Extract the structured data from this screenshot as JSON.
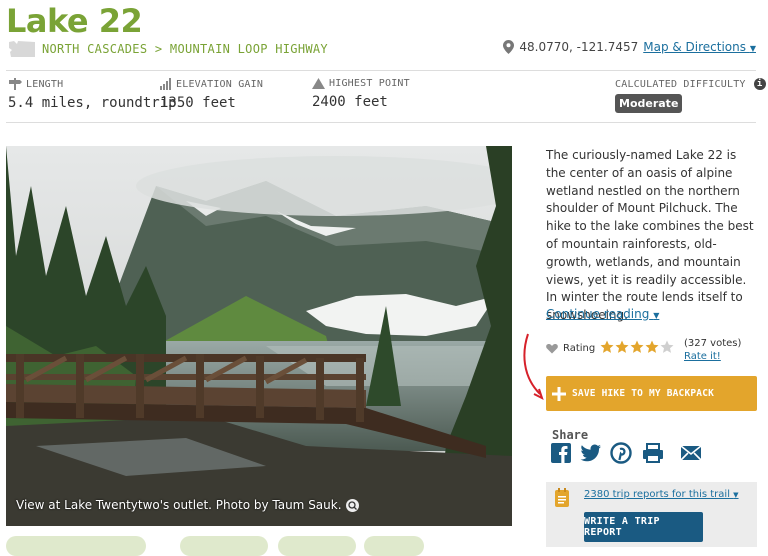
{
  "hike": {
    "title": "Lake 22",
    "breadcrumb": "NORTH CASCADES > MOUNTAIN LOOP HIGHWAY",
    "coordinates": "48.0770, -121.7457",
    "map_link": "Map & Directions"
  },
  "stats": {
    "length_label": "LENGTH",
    "length_value": "5.4 miles, roundtrip",
    "gain_label": "ELEVATION GAIN",
    "gain_value": "1350 feet",
    "high_label": "HIGHEST POINT",
    "high_value": "2400 feet",
    "difficulty_label": "CALCULATED DIFFICULTY",
    "difficulty_value": "Moderate"
  },
  "photo": {
    "caption": "View at Lake Twentytwo's outlet. Photo by Taum Sauk."
  },
  "description": {
    "text": "The curiously-named Lake 22 is the center of an oasis of alpine wetland nestled on the northern shoulder of Mount Pilchuck. The hike to the lake combines the best of mountain rainforests, old-growth, wetlands, and mountain views, yet it is readily accessible. In winter the route lends itself to snowshoeing.",
    "continue_link": "Continue reading"
  },
  "rating": {
    "label": "Rating",
    "stars": 4,
    "max_stars": 5,
    "votes": "(327 votes)",
    "rate_link": "Rate it!"
  },
  "actions": {
    "backpack_label": "SAVE HIKE TO MY BACKPACK",
    "share_label": "Share"
  },
  "trip_reports": {
    "link": "2380 trip reports for this trail",
    "button": "WRITE A TRIP REPORT"
  },
  "colors": {
    "brand_green": "#7aa336",
    "link_blue": "#1b6f9e",
    "backpack_orange": "#e3a52c",
    "trip_button": "#1a5a82",
    "star": "#e3a52c"
  },
  "icons": [
    "wa-state-icon",
    "location-pin-icon",
    "signpost-icon",
    "elevation-icon",
    "mountain-peak-icon",
    "info-icon",
    "zoom-icon",
    "heart-icon",
    "star-icon",
    "plus-icon",
    "facebook-icon",
    "twitter-icon",
    "pinterest-icon",
    "print-icon",
    "email-icon",
    "trip-report-icon",
    "chevron-down-icon"
  ]
}
